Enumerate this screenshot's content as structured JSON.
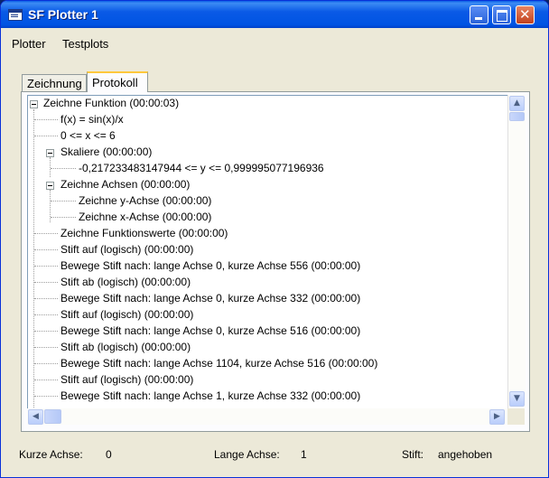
{
  "window": {
    "title": "SF Plotter 1"
  },
  "titlebar": {
    "minimize_icon": "minimize-icon",
    "maximize_icon": "maximize-icon",
    "close_icon": "close-icon",
    "close_glyph": "✕"
  },
  "menu": {
    "plotter": "Plotter",
    "testplots": "Testplots"
  },
  "tabs": {
    "zeichnung": "Zeichnung",
    "protokoll": "Protokoll",
    "active": "Protokoll"
  },
  "tree": {
    "root": "Zeichne Funktion (00:00:03)",
    "items": [
      "f(x) = sin(x)/x",
      "0 <= x <= 6",
      "Skaliere (00:00:00)",
      "-0,217233483147944 <= y <= 0,999995077196936",
      "Zeichne Achsen (00:00:00)",
      "Zeichne y-Achse (00:00:00)",
      "Zeichne x-Achse (00:00:00)",
      "Zeichne Funktionswerte (00:00:00)",
      "Stift auf (logisch) (00:00:00)",
      "Bewege Stift nach: lange Achse 0, kurze Achse 556 (00:00:00)",
      "Stift ab (logisch) (00:00:00)",
      "Bewege Stift nach: lange Achse 0, kurze Achse 332 (00:00:00)",
      "Stift auf (logisch) (00:00:00)",
      "Bewege Stift nach: lange Achse 0, kurze Achse 516 (00:00:00)",
      "Stift ab (logisch) (00:00:00)",
      "Bewege Stift nach: lange Achse 1104, kurze Achse 516 (00:00:00)",
      "Stift auf (logisch) (00:00:00)",
      "Bewege Stift nach: lange Achse 1, kurze Achse 332 (00:00:00)"
    ]
  },
  "scrollbars": {
    "up": "▲",
    "down": "▼",
    "left": "◀",
    "right": "▶"
  },
  "status": {
    "kurze_label": "Kurze Achse:",
    "kurze_value": "0",
    "lange_label": "Lange Achse:",
    "lange_value": "1",
    "stift_label": "Stift:",
    "stift_value": "angehoben"
  }
}
